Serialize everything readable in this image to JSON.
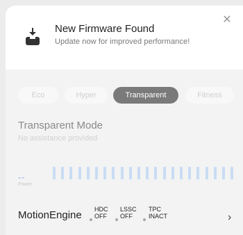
{
  "notification": {
    "title": "New Firmware Found",
    "subtitle": "Update now for improved performance!",
    "icon": "download-tray-icon",
    "close_icon": "close-icon"
  },
  "tabs": [
    {
      "label": "Eco",
      "active": false
    },
    {
      "label": "Hyper",
      "active": false
    },
    {
      "label": "Transparent",
      "active": true
    },
    {
      "label": "Fitness",
      "active": false
    }
  ],
  "mode": {
    "title": "Transparent Mode",
    "subtitle": "No assistance provided"
  },
  "power": {
    "value": "--",
    "label": "Power",
    "bar_count": 22
  },
  "engine": {
    "label": "MotionEngine",
    "statuses": [
      {
        "name": "HDC",
        "state": "OFF"
      },
      {
        "name": "LSSC",
        "state": "OFF"
      },
      {
        "name": "TPC",
        "state": "INACT"
      }
    ],
    "chevron_icon": "chevron-right-icon"
  },
  "colors": {
    "active_tab": "#7a7a7a",
    "power_accent": "#a8c4ea",
    "power_bar": "#c9dcf4"
  }
}
